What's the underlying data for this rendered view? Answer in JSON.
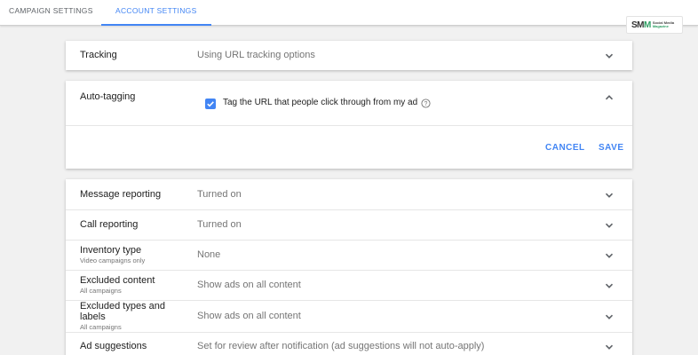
{
  "tabs": [
    {
      "label": "CAMPAIGN SETTINGS"
    },
    {
      "label": "ACCOUNT SETTINGS",
      "active": true
    }
  ],
  "logo": {
    "mark_a": "SM",
    "mark_b": "M",
    "line1": "Social Media",
    "line2": "Magazine"
  },
  "tracking": {
    "label": "Tracking",
    "value": "Using URL tracking options"
  },
  "auto_tagging": {
    "label": "Auto-tagging",
    "checkbox_label": "Tag the URL that people click through from my ad",
    "checked": true,
    "cancel_label": "CANCEL",
    "save_label": "SAVE"
  },
  "settings": [
    {
      "label": "Message reporting",
      "sub": "",
      "value": "Turned on"
    },
    {
      "label": "Call reporting",
      "sub": "",
      "value": "Turned on"
    },
    {
      "label": "Inventory type",
      "sub": "Video campaigns only",
      "value": "None"
    },
    {
      "label": "Excluded content",
      "sub": "All campaigns",
      "value": "Show ads on all content"
    },
    {
      "label_line1": "Excluded types and",
      "label_line2": "labels",
      "sub": "All campaigns",
      "value": "Show ads on all content"
    },
    {
      "label": "Ad suggestions",
      "sub": "",
      "value": "Set for review after notification (ad suggestions will not auto-apply)"
    }
  ],
  "colors": {
    "accent": "#4285f4",
    "background": "#f1f1f1",
    "muted_text": "#757575"
  },
  "icons": {
    "expand": "chevron-down-icon",
    "collapse": "chevron-up-icon",
    "help": "help-circle-icon",
    "check": "check-icon"
  }
}
